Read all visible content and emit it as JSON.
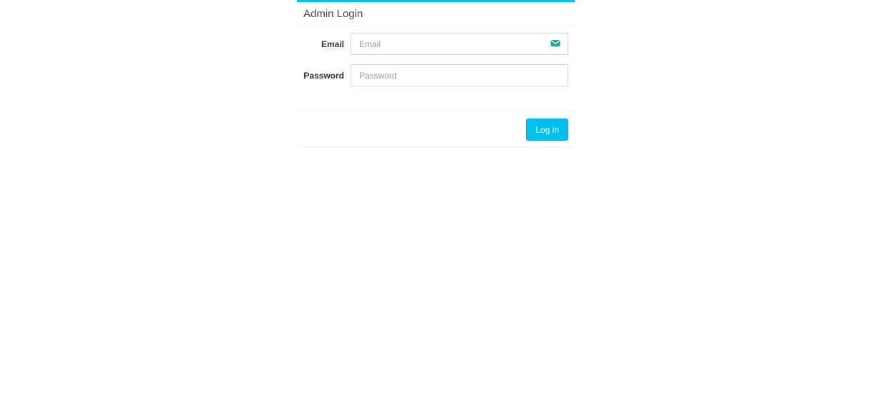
{
  "card": {
    "title": "Admin Login"
  },
  "form": {
    "email": {
      "label": "Email",
      "placeholder": "Email",
      "value": "",
      "icon": "envelope-icon"
    },
    "password": {
      "label": "Password",
      "placeholder": "Password",
      "value": ""
    }
  },
  "footer": {
    "login_label": "Log in"
  },
  "colors": {
    "accent": "#00c0ef",
    "icon": "#20a98a"
  }
}
